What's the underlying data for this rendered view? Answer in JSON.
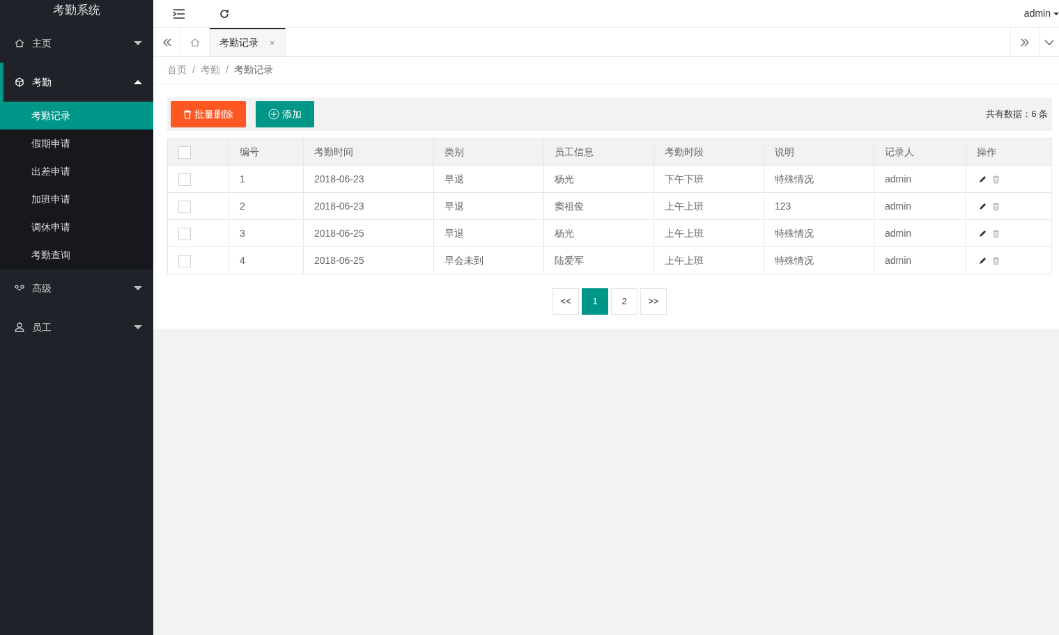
{
  "app": {
    "title": "考勤系统"
  },
  "sidebar": {
    "items": [
      {
        "label": "主页",
        "kind": "home",
        "expanded": false
      },
      {
        "label": "考勤",
        "kind": "cube",
        "expanded": true,
        "children": [
          {
            "label": "考勤记录",
            "selected": true
          },
          {
            "label": "假期申请",
            "selected": false
          },
          {
            "label": "出差申请",
            "selected": false
          },
          {
            "label": "加班申请",
            "selected": false
          },
          {
            "label": "调休申请",
            "selected": false
          },
          {
            "label": "考勤查询",
            "selected": false
          }
        ]
      },
      {
        "label": "高级",
        "kind": "link",
        "expanded": false
      },
      {
        "label": "员工",
        "kind": "user",
        "expanded": false
      }
    ]
  },
  "header": {
    "user": "admin"
  },
  "tabs": [
    {
      "kind": "home",
      "selected": false
    },
    {
      "kind": "page",
      "label": "考勤记录",
      "selected": true,
      "close": "×"
    }
  ],
  "breadcrumb": [
    "首页",
    "考勤",
    "考勤记录"
  ],
  "breadcrumb_separator": "/",
  "toolbar": {
    "buttons": [
      {
        "kind": "delete",
        "label": "批量删除"
      },
      {
        "kind": "add",
        "label": "添加"
      }
    ],
    "total": "共有数据：6 条"
  },
  "table": {
    "header_checked": false,
    "columns": [
      "编号",
      "考勤时间",
      "类别",
      "员工信息",
      "考勤时段",
      "说明",
      "记录人",
      "操作"
    ],
    "rows": [
      {
        "checked": false,
        "cells": [
          "1",
          "2018-06-23",
          "早退",
          "杨光",
          "下午下班",
          "特殊情况",
          "admin"
        ]
      },
      {
        "checked": false,
        "cells": [
          "2",
          "2018-06-23",
          "早退",
          "窦祖俊",
          "上午上班",
          "123",
          "admin"
        ]
      },
      {
        "checked": false,
        "cells": [
          "3",
          "2018-06-25",
          "早退",
          "杨光",
          "上午上班",
          "特殊情况",
          "admin"
        ]
      },
      {
        "checked": false,
        "cells": [
          "4",
          "2018-06-25",
          "早会未到",
          "陆爱军",
          "上午上班",
          "特殊情况",
          "admin"
        ]
      }
    ]
  },
  "pagination": {
    "prev": "<<",
    "pages": [
      {
        "label": "1",
        "selected": true
      },
      {
        "label": "2",
        "selected": false
      }
    ],
    "next": ">>"
  }
}
